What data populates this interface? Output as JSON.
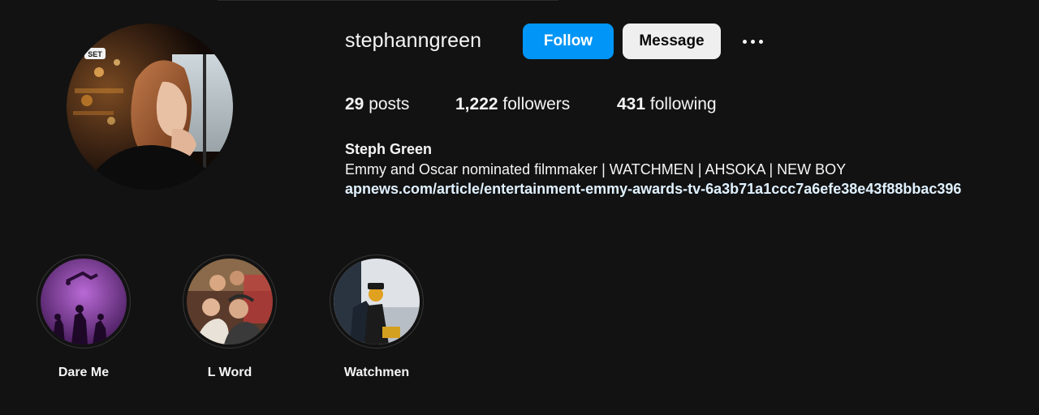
{
  "profile": {
    "username": "stephanngreen",
    "follow_label": "Follow",
    "message_label": "Message",
    "more_icon": "ellipsis-icon",
    "avatar_badge": "SET",
    "stats": {
      "posts_count": "29",
      "posts_label": "posts",
      "followers_count": "1,222",
      "followers_label": "followers",
      "following_count": "431",
      "following_label": "following"
    },
    "bio": {
      "name": "Steph Green",
      "text": "Emmy and Oscar nominated filmmaker | WATCHMEN | AHSOKA | NEW BOY",
      "link": "apnews.com/article/entertainment-emmy-awards-tv-6a3b71a1ccc7a6efe38e43f88bbac396"
    }
  },
  "highlights": [
    {
      "label": "Dare Me"
    },
    {
      "label": "L Word"
    },
    {
      "label": "Watchmen"
    }
  ],
  "colors": {
    "background": "#121212",
    "follow_button": "#0095f6",
    "message_button": "#efefef",
    "link": "#e0f1ff"
  }
}
